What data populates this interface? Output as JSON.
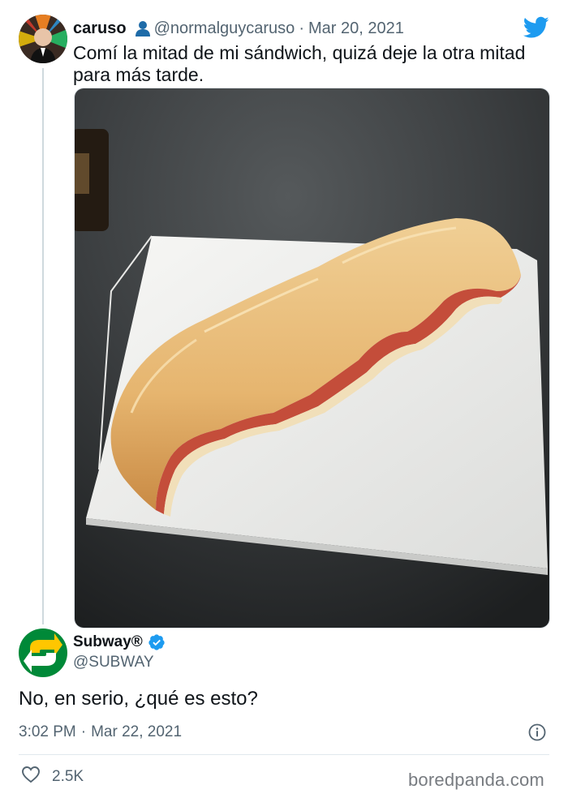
{
  "tweet1": {
    "name": "caruso",
    "handle": "@normalguycaruso",
    "separator": "·",
    "date": "Mar 20, 2021",
    "text": "Comí la mitad de mi sándwich, quizá deje la otra mitad para más tarde.",
    "icons": {
      "person": "person-icon",
      "brand": "twitter-bird-icon"
    },
    "photo_subject": "half-eaten-sandwich-photo"
  },
  "tweet2": {
    "name": "Subway®",
    "handle": "@SUBWAY",
    "text": "No, en serio, ¿qué es esto?",
    "time": "3:02 PM",
    "separator": "·",
    "date": "Mar 22, 2021",
    "likes": "2.5K",
    "icons": {
      "verified": "verified-badge-icon",
      "info": "info-icon",
      "like": "heart-icon"
    }
  },
  "watermark": "boredpanda.com",
  "colors": {
    "text": "#0f1419",
    "secondary": "#536471",
    "twitter_blue": "#1d9bf0",
    "subway_green": "#008938",
    "subway_yellow": "#ffc600",
    "thread_line": "#cfd9de"
  }
}
